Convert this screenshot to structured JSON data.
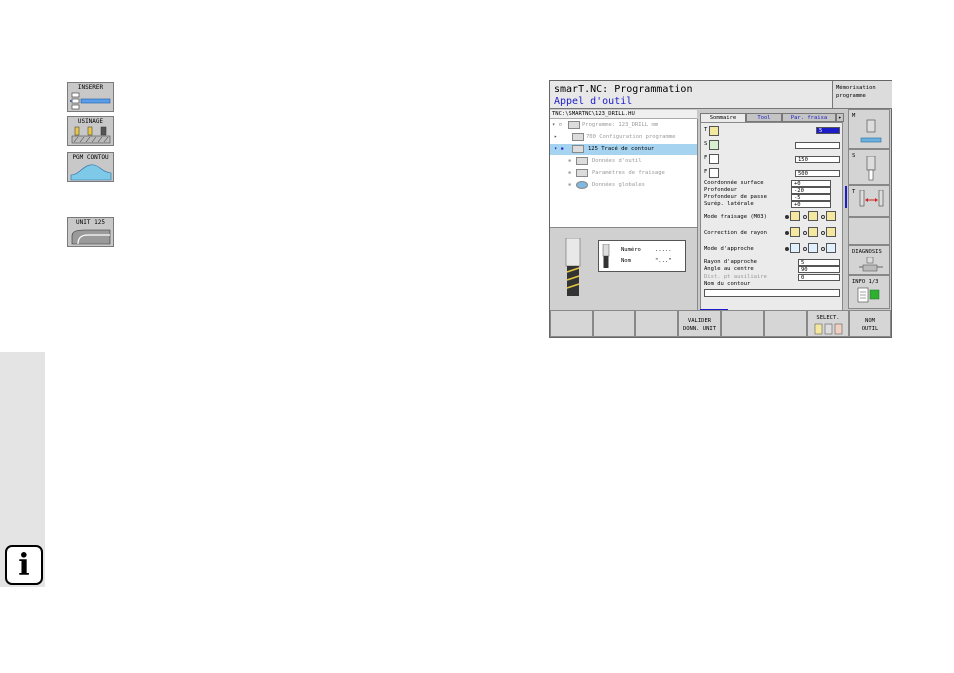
{
  "left_softkeys": [
    {
      "label": "INSERER",
      "icon": "insert-block-icon"
    },
    {
      "label": "USINAGE",
      "icon": "machining-icon"
    },
    {
      "label": "PGM CONTOU",
      "icon": "contour-program-icon"
    },
    {
      "label": "UNIT 125",
      "icon": "contour-train-icon"
    }
  ],
  "info_glyph": "i",
  "screen": {
    "title": "smarT.NC: Programmation",
    "subtitle": "Appel d'outil",
    "mode_lines": [
      "Mémorisation",
      "programme"
    ],
    "path": "TNC:\\SMARTNC\\123_DRILL.HU",
    "tree": [
      {
        "label": "Programme: 123_DRILL mm",
        "marker": "▾ ▫"
      },
      {
        "label": "700 Configuration programme",
        "marker": "▸"
      },
      {
        "label": "125 Tracé de contour",
        "marker": "▾ ▪"
      },
      {
        "label": "Données d'outil",
        "marker": "▪"
      },
      {
        "label": "Paramètres de fraisage",
        "marker": "▪"
      },
      {
        "label": "Données globales",
        "marker": "▪"
      }
    ],
    "preview": {
      "rows": [
        {
          "label": "Numéro",
          "value": "....."
        },
        {
          "label": "Nom",
          "value": "\"...\""
        }
      ]
    },
    "tabs": [
      "Sommaire",
      "Tool",
      "Par. fraisa"
    ],
    "form": {
      "tool_rows": [
        {
          "key": "T",
          "value": "5"
        },
        {
          "key": "S",
          "value": ""
        },
        {
          "key": "F",
          "value": "150"
        },
        {
          "key": "F",
          "value": "500"
        }
      ],
      "fields": [
        {
          "label": "Coordonnée surface",
          "value": "+0"
        },
        {
          "label": "Profondeur",
          "value": "-20"
        },
        {
          "label": "Profondeur de passe",
          "value": "-5"
        },
        {
          "label": "Surép. latérale",
          "value": "+0"
        }
      ],
      "mode_fraisage": "Mode fraisage (M03)",
      "correction": "Correction de rayon",
      "approche": "Mode d'approche",
      "rayon_label": "Rayon d'approche",
      "rayon_value": "5",
      "angle_label": "Angle au centre",
      "angle_value": "90",
      "dist_label": "Dist. pt auxiliaire",
      "dist_value": "0",
      "nom_contour_label": "Nom du contour",
      "nom_contour_value": ""
    },
    "right_softkeys": [
      {
        "label": "M"
      },
      {
        "label": "S"
      },
      {
        "label": "T"
      },
      {
        "label": ""
      },
      {
        "label": "DIAGNOSIS"
      },
      {
        "label": "INFO 1/3"
      }
    ],
    "bottom_softkeys": [
      {
        "l1": "",
        "l2": ""
      },
      {
        "l1": "",
        "l2": ""
      },
      {
        "l1": "",
        "l2": ""
      },
      {
        "l1": "VALIDER",
        "l2": "DONN. UNIT"
      },
      {
        "l1": "",
        "l2": ""
      },
      {
        "l1": "",
        "l2": ""
      },
      {
        "l1": "SELECT.",
        "l2": ""
      },
      {
        "l1": "NOM",
        "l2": "OUTIL"
      }
    ]
  }
}
